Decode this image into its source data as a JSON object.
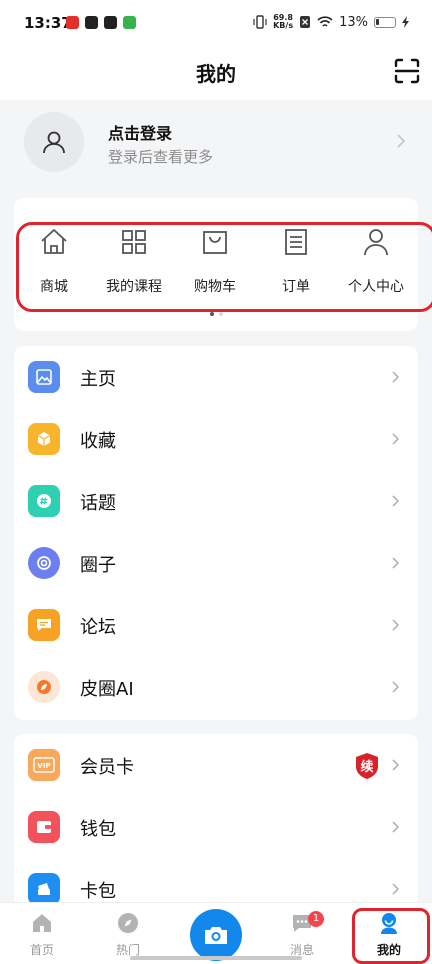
{
  "status_bar": {
    "time": "13:37",
    "net_speed_value": "69.8",
    "net_speed_unit": "KB/s",
    "battery": "13%"
  },
  "header": {
    "title": "我的"
  },
  "login": {
    "title": "点击登录",
    "subtitle": "登录后查看更多"
  },
  "quick_links": [
    {
      "label": "商城",
      "icon": "home-icon"
    },
    {
      "label": "我的课程",
      "icon": "grid-icon"
    },
    {
      "label": "购物车",
      "icon": "bag-icon"
    },
    {
      "label": "订单",
      "icon": "list-icon"
    },
    {
      "label": "个人中心",
      "icon": "person-icon"
    }
  ],
  "menu_primary": [
    {
      "label": "主页",
      "icon": "picture-icon",
      "color": "#5b8def"
    },
    {
      "label": "收藏",
      "icon": "cube-icon",
      "color": "#f7b52c"
    },
    {
      "label": "话题",
      "icon": "hashtag-icon",
      "color": "#2fcfb2"
    },
    {
      "label": "圈子",
      "icon": "circle-icon",
      "color": "#6c7ff0"
    },
    {
      "label": "论坛",
      "icon": "chat-icon",
      "color": "#f7a224"
    },
    {
      "label": "皮圈AI",
      "icon": "ai-leaf-icon",
      "color": "#f4792b"
    }
  ],
  "menu_secondary": [
    {
      "label": "会员卡",
      "icon": "vip-card-icon",
      "color": "#f7a85a"
    },
    {
      "label": "钱包",
      "icon": "wallet-icon",
      "color": "#f2535b"
    },
    {
      "label": "卡包",
      "icon": "card-pack-icon",
      "color": "#1e8ef0"
    }
  ],
  "renew_badge": "续",
  "tabbar": {
    "items": [
      {
        "label": "首页",
        "icon": "home-icon"
      },
      {
        "label": "热门",
        "icon": "compass-icon"
      },
      {
        "label": "消息",
        "icon": "message-icon"
      },
      {
        "label": "我的",
        "icon": "profile-icon"
      }
    ],
    "message_badge": "1"
  },
  "colors": {
    "accent": "#1287ec",
    "highlight": "#e0242e",
    "background": "#f4f5f7"
  }
}
